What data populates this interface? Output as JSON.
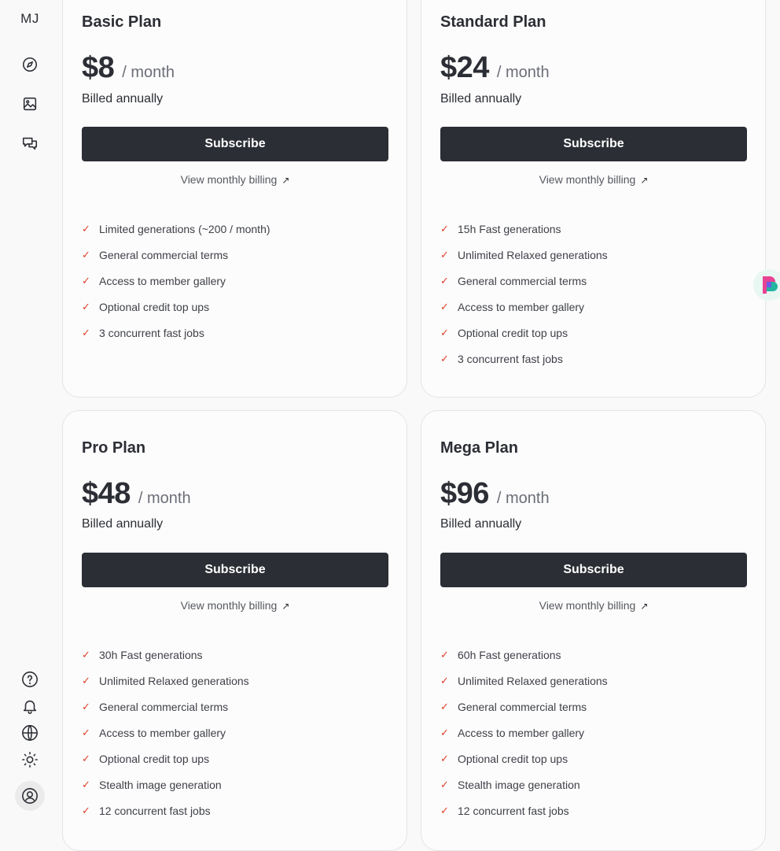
{
  "sidebar": {
    "logo": "MJ",
    "top_icons": [
      "compass-icon",
      "image-icon",
      "chat-icon"
    ],
    "bottom_icons": [
      "help-icon",
      "bell-icon",
      "globe-icon",
      "sun-icon",
      "user-icon"
    ]
  },
  "colors": {
    "button_bg": "#2c2e35",
    "check": "#e0402a",
    "card_border": "#e4e4e7"
  },
  "plans": [
    {
      "title": "Basic Plan",
      "price": "$8",
      "per": "/ month",
      "billed": "Billed annually",
      "subscribe_label": "Subscribe",
      "monthly_link": "View monthly billing",
      "features": [
        "Limited generations (~200 / month)",
        "General commercial terms",
        "Access to member gallery",
        "Optional credit top ups",
        "3 concurrent fast jobs"
      ]
    },
    {
      "title": "Standard Plan",
      "price": "$24",
      "per": "/ month",
      "billed": "Billed annually",
      "subscribe_label": "Subscribe",
      "monthly_link": "View monthly billing",
      "features": [
        "15h Fast generations",
        "Unlimited Relaxed generations",
        "General commercial terms",
        "Access to member gallery",
        "Optional credit top ups",
        "3 concurrent fast jobs"
      ]
    },
    {
      "title": "Pro Plan",
      "price": "$48",
      "per": "/ month",
      "billed": "Billed annually",
      "subscribe_label": "Subscribe",
      "monthly_link": "View monthly billing",
      "features": [
        "30h Fast generations",
        "Unlimited Relaxed generations",
        "General commercial terms",
        "Access to member gallery",
        "Optional credit top ups",
        "Stealth image generation",
        "12 concurrent fast jobs"
      ]
    },
    {
      "title": "Mega Plan",
      "price": "$96",
      "per": "/ month",
      "billed": "Billed annually",
      "subscribe_label": "Subscribe",
      "monthly_link": "View monthly billing",
      "features": [
        "60h Fast generations",
        "Unlimited Relaxed generations",
        "General commercial terms",
        "Access to member gallery",
        "Optional credit top ups",
        "Stealth image generation",
        "12 concurrent fast jobs"
      ]
    }
  ]
}
